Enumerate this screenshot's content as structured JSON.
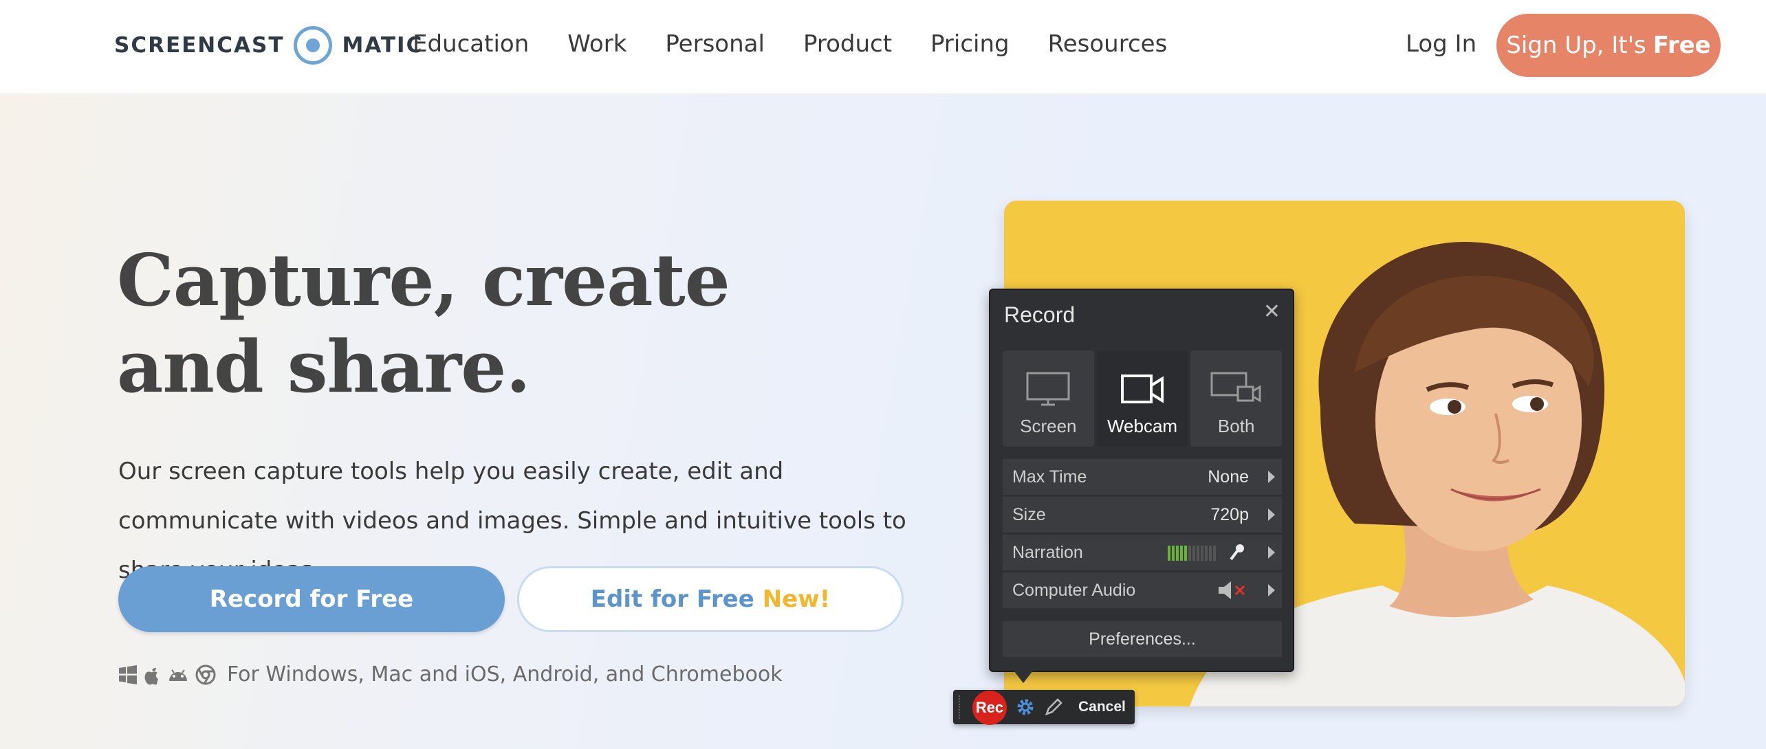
{
  "header": {
    "logo_left": "SCREENCAST",
    "logo_right": "MATIC",
    "nav": [
      "Education",
      "Work",
      "Personal",
      "Product",
      "Pricing",
      "Resources"
    ],
    "login": "Log In",
    "signup_prefix": "Sign Up, It's",
    "signup_bold": "Free"
  },
  "hero": {
    "headline": "Capture, create and share.",
    "description": "Our screen capture tools help you easily create, edit and communicate with videos and images. Simple and intuitive tools to share your ideas.",
    "record_button": "Record for Free",
    "edit_button": "Edit for Free",
    "edit_badge": "New!",
    "platforms_text": "For Windows, Mac and iOS, Android, and Chromebook",
    "platform_icons": [
      "windows-icon",
      "apple-icon",
      "android-icon",
      "chrome-icon"
    ]
  },
  "recorder": {
    "title": "Record",
    "modes": [
      "Screen",
      "Webcam",
      "Both"
    ],
    "active_mode": "Webcam",
    "rows": [
      {
        "label": "Max Time",
        "value": "None"
      },
      {
        "label": "Size",
        "value": "720p"
      },
      {
        "label": "Narration",
        "value": ""
      },
      {
        "label": "Computer Audio",
        "value": ""
      }
    ],
    "narration_level": 0.4,
    "preferences": "Preferences...",
    "rec_label": "Rec",
    "cancel_label": "Cancel"
  },
  "colors": {
    "accent_orange": "#e58466",
    "accent_blue": "#6a9fd3",
    "badge_yellow": "#f0b72f",
    "photo_background": "#f5c842"
  }
}
